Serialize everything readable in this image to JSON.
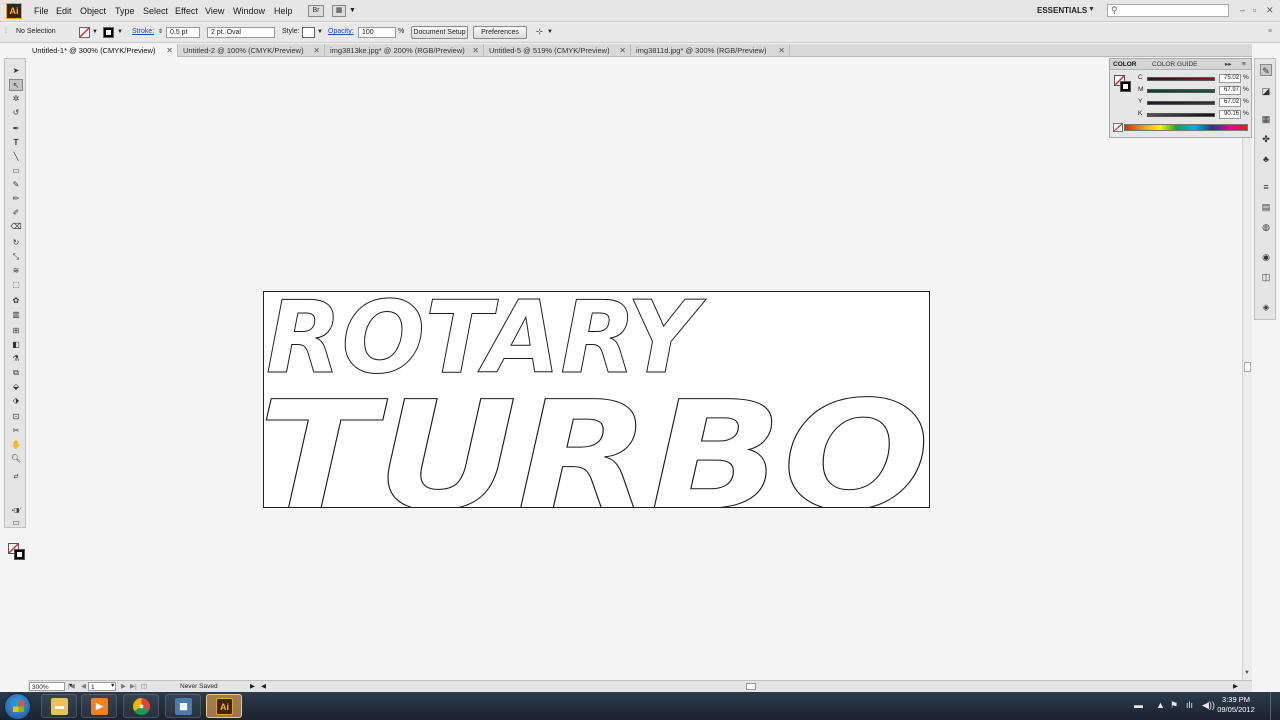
{
  "app": {
    "logo_text": "Ai",
    "menus": [
      "File",
      "Edit",
      "Object",
      "Type",
      "Select",
      "Effect",
      "View",
      "Window",
      "Help"
    ],
    "workspace": "ESSENTIALS",
    "search_placeholder": ""
  },
  "control": {
    "selection": "No Selection",
    "stroke_label": "Stroke:",
    "stroke_value": "0.5 pt",
    "brush": "2 pt. Oval",
    "style_label": "Style:",
    "opacity_label": "Opacity:",
    "opacity_value": "100",
    "opacity_unit": "%",
    "document_setup": "Document Setup",
    "preferences": "Preferences"
  },
  "tabs": [
    {
      "label": "Untitled-1* @ 300% (CMYK/Preview)",
      "active": true
    },
    {
      "label": "Untitled-2 @ 100% (CMYK/Preview)",
      "active": false
    },
    {
      "label": "img3813ke.jpg* @ 200% (RGB/Preview)",
      "active": false
    },
    {
      "label": "Untitled-5 @ 519% (CMYK/Preview)",
      "active": false
    },
    {
      "label": "img3811d.jpg* @ 300% (RGB/Preview)",
      "active": false
    }
  ],
  "color_panel": {
    "tabs": [
      "COLOR",
      "COLOR GUIDE"
    ],
    "channels": [
      {
        "label": "C",
        "value": "75.02",
        "unit": "%",
        "color": "#8a1a1a"
      },
      {
        "label": "M",
        "value": "67.97",
        "unit": "%",
        "color": "#1a5a3a"
      },
      {
        "label": "Y",
        "value": "67.02",
        "unit": "%",
        "color": "#2a2a2a"
      },
      {
        "label": "K",
        "value": "90.16",
        "unit": "%",
        "color": "#202020"
      }
    ]
  },
  "artboard": {
    "line1": "ROTARY",
    "line2": "TURBO",
    "stroke_color": "#1a1a1a"
  },
  "status": {
    "zoom": "300%",
    "artboard_num": "1",
    "save_state": "Never Saved"
  },
  "taskbar": {
    "time": "3:39 PM",
    "date": "09/05/2012",
    "apps": [
      "folder",
      "media-player",
      "chrome",
      "network",
      "illustrator"
    ]
  },
  "icons": {
    "search": "search-icon",
    "arrange": "arrange-documents-icon",
    "bridge": "bridge-icon"
  }
}
